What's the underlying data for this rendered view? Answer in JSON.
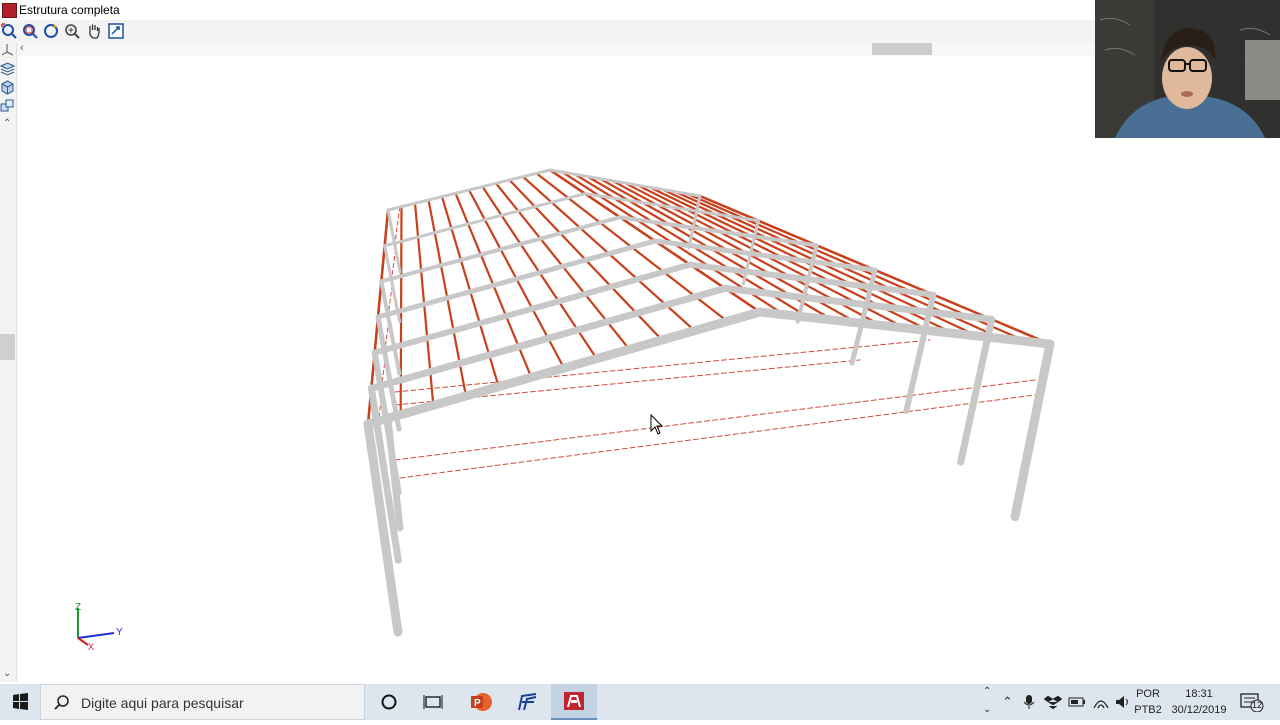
{
  "window": {
    "title": "Estrutura completa"
  },
  "toolbar": {
    "buttons": [
      "zoom-fit-icon",
      "zoom-window-icon",
      "rotate-icon",
      "zoom-icon",
      "pan-hand-icon",
      "view-select-icon"
    ]
  },
  "sidebar": {
    "buttons": [
      "axes-icon",
      "layers-icon",
      "cube-view-icon",
      "cubes-icon"
    ]
  },
  "scene": {
    "frame_color": "#c8c8c8",
    "purlin_color": "#c8401c",
    "bracing_color": "#d04a3a",
    "axes": {
      "z": "Z",
      "y": "Y",
      "x": "X"
    }
  },
  "taskbar": {
    "search_placeholder": "Digite aqui para pesquisar",
    "language": "POR",
    "layout": "PTB2",
    "time": "18:31",
    "date": "30/12/2019",
    "notifications": "12"
  }
}
